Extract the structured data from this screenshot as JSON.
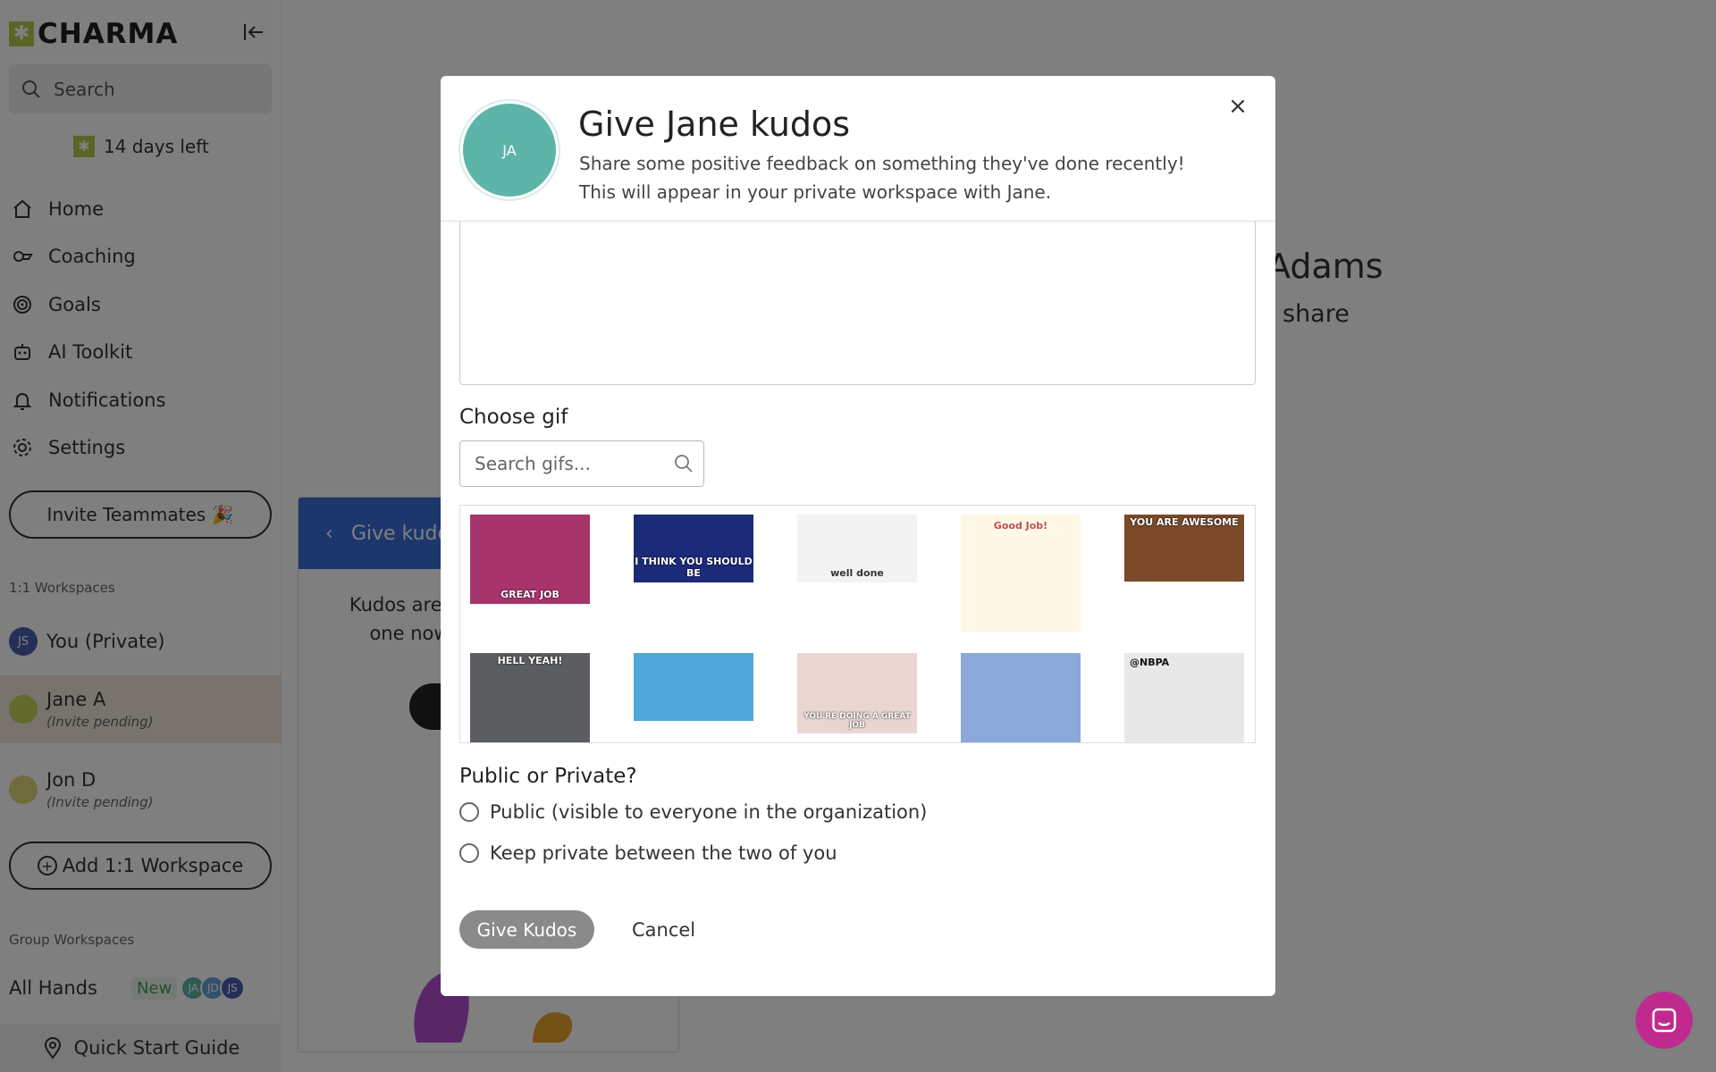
{
  "app": {
    "logo_text": "CHARMA",
    "logo_mark": "✱"
  },
  "sidebar": {
    "search_placeholder": "Search",
    "trial_text": "14 days left",
    "nav": [
      {
        "label": "Home",
        "icon": "home-icon"
      },
      {
        "label": "Coaching",
        "icon": "coaching-icon"
      },
      {
        "label": "Goals",
        "icon": "goals-icon"
      },
      {
        "label": "AI Toolkit",
        "icon": "robot-icon"
      },
      {
        "label": "Notifications",
        "icon": "bell-icon"
      },
      {
        "label": "Settings",
        "icon": "gear-icon"
      }
    ],
    "invite_label": "Invite Teammates 🎉",
    "workspaces_label": "1:1 Workspaces",
    "workspaces": [
      {
        "name": "You (Private)",
        "initials": "JS",
        "sub": ""
      },
      {
        "name": "Jane A",
        "initials": "",
        "sub": "(Invite pending)"
      },
      {
        "name": "Jon D",
        "initials": "",
        "sub": "(Invite pending)"
      }
    ],
    "add_workspace_label": "Add 1:1 Workspace",
    "group_label": "Group Workspaces",
    "group_name": "All Hands",
    "group_badge": "New",
    "group_avatars": [
      "JA",
      "JD",
      "JS"
    ],
    "quick_start_label": "Quick Start Guide"
  },
  "background": {
    "title_fragment": "Adams",
    "share_fragment": "share",
    "panel_header": "Give kudo",
    "panel_text": "Kudos are lik one now"
  },
  "modal": {
    "avatar_initials": "JA",
    "title": "Give Jane kudos",
    "subtitle": "Share some positive feedback on something they've done recently! This will appear in your private workspace with Jane.",
    "choose_gif_label": "Choose gif",
    "gif_search_placeholder": "Search gifs...",
    "gifs": [
      {
        "caption": "GREAT JOB",
        "bg": "#a8346c"
      },
      {
        "caption": "I THINK YOU SHOULD BE",
        "bg": "#1c2a7a"
      },
      {
        "caption": "well done",
        "bg": "#f3f3f3"
      },
      {
        "caption": "Good Job!",
        "bg": "#fff8e6"
      },
      {
        "caption": "YOU ARE AWESOME",
        "bg": "#7a4a2a"
      },
      {
        "caption": "HELL YEAH!",
        "bg": "#5b5d60"
      },
      {
        "caption": "",
        "bg": "#4fa8d8"
      },
      {
        "caption": "YOU'RE DOING A GREAT JOB",
        "bg": "#e9d6d0"
      },
      {
        "caption": "",
        "bg": "#8aa8d8"
      },
      {
        "caption": "@NBPA",
        "bg": "#e8e8e8"
      }
    ],
    "privacy_title": "Public or Private?",
    "options": [
      "Public (visible to everyone in the organization)",
      "Keep private between the two of you"
    ],
    "give_label": "Give Kudos",
    "cancel_label": "Cancel"
  },
  "colors": {
    "brand": "#b8c94a",
    "avatar_teal": "#5cb5a8",
    "chat_fab": "#c02a8e",
    "panel_blue": "#3b6fd8"
  }
}
